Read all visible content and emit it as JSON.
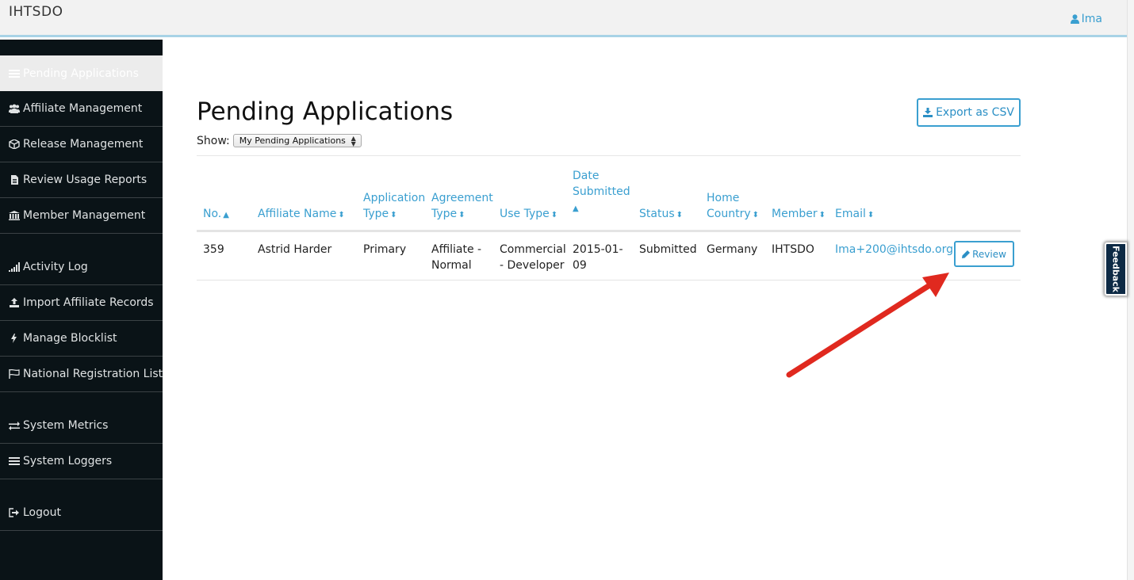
{
  "header": {
    "brand": "IHTSDO",
    "user_name": "Ima"
  },
  "sidebar": {
    "items": [
      {
        "label": "Pending Applications",
        "icon": "list-icon",
        "active": true
      },
      {
        "label": "Affiliate Management",
        "icon": "users-icon"
      },
      {
        "label": "Release Management",
        "icon": "cube-icon"
      },
      {
        "label": "Review Usage Reports",
        "icon": "file-text-icon"
      },
      {
        "label": "Member Management",
        "icon": "bank-icon"
      },
      {
        "label": "Activity Log",
        "icon": "signal-icon"
      },
      {
        "label": "Import Affiliate Records",
        "icon": "upload-icon"
      },
      {
        "label": "Manage Blocklist",
        "icon": "bolt-icon"
      },
      {
        "label": "National Registration List",
        "icon": "flag-icon"
      },
      {
        "label": "System Metrics",
        "icon": "exchange-icon"
      },
      {
        "label": "System Loggers",
        "icon": "bars-icon"
      },
      {
        "label": "Logout",
        "icon": "sign-out-icon"
      }
    ]
  },
  "main": {
    "title": "Pending Applications",
    "export_label": "Export as CSV",
    "show_label": "Show:",
    "show_selected": "My Pending Applications",
    "table": {
      "headers": [
        {
          "line1": "No.",
          "line2": ""
        },
        {
          "line1": "Affiliate Name",
          "line2": ""
        },
        {
          "line1": "Application",
          "line2": "Type"
        },
        {
          "line1": "Agreement",
          "line2": "Type"
        },
        {
          "line1": "Use Type",
          "line2": ""
        },
        {
          "line1": "Date",
          "line2": "Submitted"
        },
        {
          "line1": "Status",
          "line2": ""
        },
        {
          "line1": "Home",
          "line2": "Country"
        },
        {
          "line1": "Member",
          "line2": ""
        },
        {
          "line1": "Email",
          "line2": ""
        }
      ],
      "rows": [
        {
          "no": "359",
          "affiliate_name": "Astrid Harder",
          "application_type": "Primary",
          "agreement_type_1": "Affiliate -",
          "agreement_type_2": "Normal",
          "use_type_1": "Commercial",
          "use_type_2": "- Developer",
          "date_1": "2015-01-",
          "date_2": "09",
          "status": "Submitted",
          "home_country": "Germany",
          "member": "IHTSDO",
          "email": "Ima+200@ihtsdo.org",
          "review_label": "Review"
        }
      ]
    }
  },
  "feedback": {
    "label": "Feedback"
  },
  "colors": {
    "accent": "#3a9fd0",
    "sidebar_bg": "#0a1317",
    "annotation_arrow": "#e0291f"
  }
}
